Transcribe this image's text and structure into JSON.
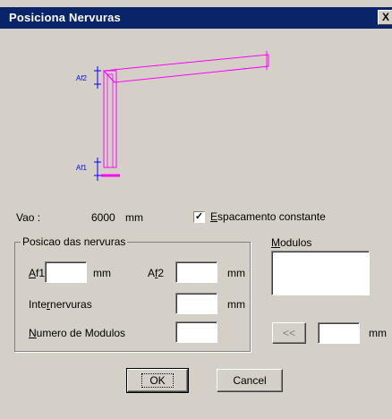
{
  "window": {
    "title": "Posiciona Nervuras",
    "close": "X"
  },
  "diagram": {
    "af2_label": "Af2",
    "af1_label": "Af1",
    "beam_color": "#ff00ff",
    "dim_color": "#0000ff"
  },
  "vao": {
    "label": "Vao :",
    "value": "6000",
    "unit": "mm"
  },
  "espacamento": {
    "label_u": "E",
    "label_rest": "spacamento constante",
    "checked": true,
    "mark": "✓"
  },
  "posicao": {
    "title": "Posicao das nervuras",
    "af1": {
      "label_u": "A",
      "label_rest": "f1",
      "value": "",
      "unit": "mm"
    },
    "af2": {
      "label_pre": "A",
      "label_u": "f",
      "label_rest": "2",
      "value": "",
      "unit": "mm"
    },
    "internervuras": {
      "label_pre": "Inte",
      "label_u": "r",
      "label_rest": "nervuras",
      "value": "",
      "unit": "mm"
    },
    "numero": {
      "label_u": "N",
      "label_rest": "umero de Modulos",
      "value": ""
    }
  },
  "modulos": {
    "label_u": "M",
    "label_rest": "odulos",
    "value": "",
    "back": "<<",
    "unit": "mm"
  },
  "buttons": {
    "ok": "OK",
    "cancel": "Cancel"
  }
}
